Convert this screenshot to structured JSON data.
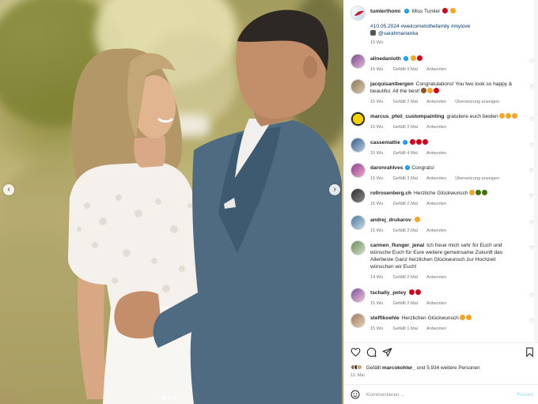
{
  "post": {
    "author": "tumlerthomi",
    "caption": "Miss Tumler",
    "hashtags": "#10.05.2024 #welcometothefamily #mylove",
    "mention": "@sarahmarianka",
    "age": "15 Wo."
  },
  "comments": [
    {
      "user": "alinedanioth",
      "verified": true,
      "text": "",
      "emoji": [
        "#f5a623",
        "#d0021b"
      ],
      "time": "15 Wo.",
      "likes": "Gefällt 9 Mal",
      "reply": "Antworten",
      "translate": ""
    },
    {
      "user": "jacquisantbergen",
      "verified": false,
      "text": "Congratulations! You two look so happy & beautiful. All the best!",
      "emoji": [
        "#8b572a",
        "#f5a623",
        "#d0021b"
      ],
      "time": "15 Wo.",
      "likes": "Gefällt 2 Mal",
      "reply": "Antworten",
      "translate": "Übersetzung anzeigen"
    },
    {
      "user": "marcus_pfeil_custompainting",
      "verified": false,
      "text": "gratuliere euch beiden",
      "emoji": [
        "#f5a623",
        "#f5a623",
        "#f5a623"
      ],
      "time": "15 Wo.",
      "likes": "Gefällt 2 Mal",
      "reply": "Antworten",
      "translate": ""
    },
    {
      "user": "cassemattie",
      "verified": true,
      "text": "",
      "emoji": [
        "#d0021b",
        "#d0021b",
        "#d0021b"
      ],
      "time": "15 Wo.",
      "likes": "Gefällt 4 Mal",
      "reply": "Antworten",
      "translate": ""
    },
    {
      "user": "daronrahlves",
      "verified": true,
      "text": "Congrats!",
      "emoji": [],
      "time": "15 Wo.",
      "likes": "Gefällt 3 Mal",
      "reply": "Antworten",
      "translate": "Übersetzung anzeigen"
    },
    {
      "user": "rollrosenberg.ch",
      "verified": false,
      "text": "Herzliche Glückwunsch",
      "emoji": [
        "#f5a623",
        "#417505",
        "#417505"
      ],
      "time": "15 Wo.",
      "likes": "Gefällt 2 Mal",
      "reply": "Antworten",
      "translate": ""
    },
    {
      "user": "andrej_drukarov",
      "verified": false,
      "text": "",
      "emoji": [
        "#f5a623"
      ],
      "time": "15 Wo.",
      "likes": "Gefällt 2 Mal",
      "reply": "Antworten",
      "translate": ""
    },
    {
      "user": "carmen_flunger_jenal",
      "verified": false,
      "text": "Ich freue mich sehr für Euch und wünsche Euch für Eure weitere gemeinsame Zukunft das Allerbeste  Ganz herzlichen Glückwunsch zur Hochzeit wünschen wir Euch!",
      "emoji": [],
      "time": "14 Wo.",
      "likes": "Gefällt 2 Mal",
      "reply": "Antworten",
      "translate": ""
    },
    {
      "user": "tschally_petey",
      "verified": false,
      "text": "",
      "emoji": [
        "#d0021b",
        "#d0021b"
      ],
      "time": "15 Wo.",
      "likes": "Gefällt 2 Mal",
      "reply": "Antworten",
      "translate": ""
    },
    {
      "user": "steffikoehle",
      "verified": false,
      "text": "Herzlichen Glückwunsch",
      "emoji": [
        "#f5a623",
        "#f5a623"
      ],
      "time": "15 Wo.",
      "likes": "Gefällt 1 Mal",
      "reply": "Antworten",
      "translate": ""
    }
  ],
  "likes_line": {
    "prefix": "Gefällt",
    "user": "marcokohler_",
    "suffix": "und 5.934 weitere Personen"
  },
  "post_date": "12. Mai",
  "comment_box": {
    "placeholder": "Kommentieren ...",
    "post": "Posten"
  },
  "icons": {
    "heart": "heart-icon",
    "comment": "comment-icon",
    "share": "share-icon",
    "save": "bookmark-icon",
    "emoji": "smiley-icon",
    "prev": "chevron-left-icon",
    "next": "chevron-right-icon"
  },
  "colors": {
    "link": "#00376b",
    "verified": "#0095f6",
    "meta": "#737373"
  }
}
